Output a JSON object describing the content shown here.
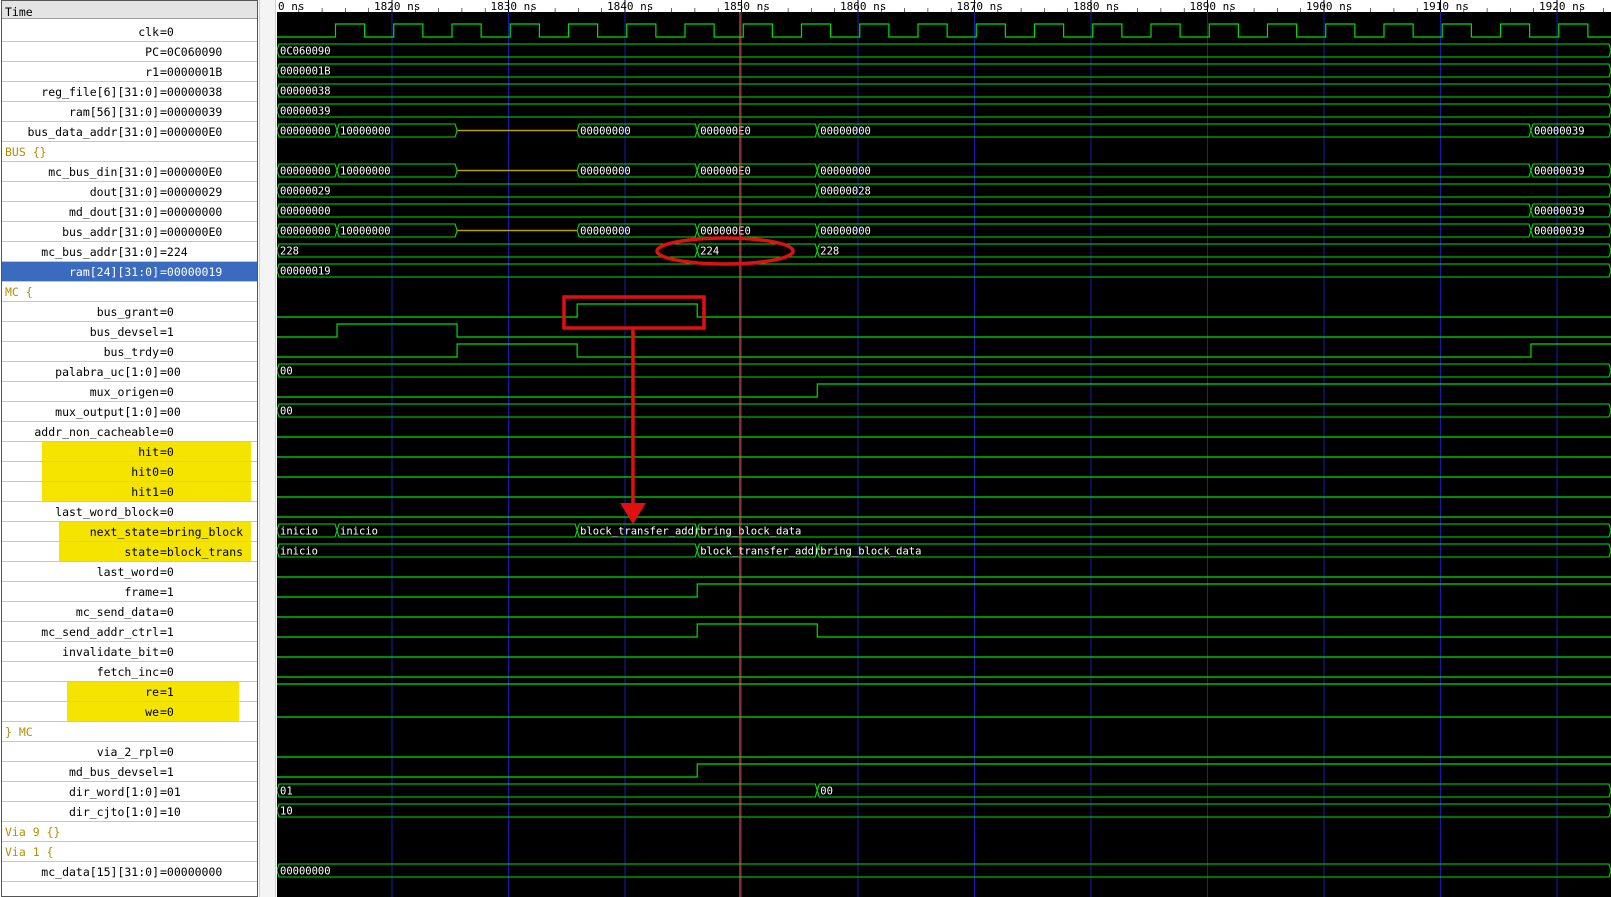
{
  "time_header": "Time",
  "ruler": {
    "first_label": "0 ns",
    "labels": [
      "1820 ns",
      "1830 ns",
      "1840 ns",
      "1850 ns",
      "1860 ns",
      "1870 ns",
      "1880 ns",
      "1890 ns",
      "1900 ns",
      "1910 ns",
      "1920 ns"
    ]
  },
  "signals": [
    {
      "name": "clk",
      "value": "0",
      "kind": "clock"
    },
    {
      "name": "PC",
      "value": "0C060090",
      "kind": "bus",
      "segments": [
        {
          "start": 0,
          "end": 100,
          "label": "0C060090"
        }
      ]
    },
    {
      "name": "r1",
      "value": "0000001B",
      "kind": "bus",
      "segments": [
        {
          "start": 0,
          "end": 100,
          "label": "0000001B"
        }
      ]
    },
    {
      "name": "reg_file[6][31:0]",
      "value": "00000038",
      "kind": "bus",
      "segments": [
        {
          "start": 0,
          "end": 100,
          "label": "00000038"
        }
      ]
    },
    {
      "name": "ram[56][31:0]",
      "value": "00000039",
      "kind": "bus",
      "segments": [
        {
          "start": 0,
          "end": 100,
          "label": "00000039"
        }
      ]
    },
    {
      "name": "bus_data_addr[31:0]",
      "value": "000000E0",
      "kind": "bus",
      "segments": [
        {
          "start": 0,
          "end": 4.5,
          "label": "00000000"
        },
        {
          "start": 4.5,
          "end": 13.5,
          "label": "10000000"
        },
        {
          "start": 13.5,
          "end": 22.5,
          "label": "",
          "z": true
        },
        {
          "start": 22.5,
          "end": 31.5,
          "label": "00000000"
        },
        {
          "start": 31.5,
          "end": 40.5,
          "label": "000000E0"
        },
        {
          "start": 40.5,
          "end": 94,
          "label": "00000000"
        },
        {
          "start": 94,
          "end": 100,
          "label": "00000039"
        }
      ]
    },
    {
      "name": "BUS {}",
      "value": "",
      "kind": "group"
    },
    {
      "name": "mc_bus_din[31:0]",
      "value": "000000E0",
      "kind": "bus",
      "segments": [
        {
          "start": 0,
          "end": 4.5,
          "label": "00000000"
        },
        {
          "start": 4.5,
          "end": 13.5,
          "label": "10000000"
        },
        {
          "start": 13.5,
          "end": 22.5,
          "label": "",
          "z": true
        },
        {
          "start": 22.5,
          "end": 31.5,
          "label": "00000000"
        },
        {
          "start": 31.5,
          "end": 40.5,
          "label": "000000E0"
        },
        {
          "start": 40.5,
          "end": 94,
          "label": "00000000"
        },
        {
          "start": 94,
          "end": 100,
          "label": "00000039"
        }
      ]
    },
    {
      "name": "dout[31:0]",
      "value": "00000029",
      "kind": "bus",
      "segments": [
        {
          "start": 0,
          "end": 40.5,
          "label": "00000029"
        },
        {
          "start": 40.5,
          "end": 100,
          "label": "00000028"
        }
      ]
    },
    {
      "name": "md_dout[31:0]",
      "value": "00000000",
      "kind": "bus",
      "segments": [
        {
          "start": 0,
          "end": 94,
          "label": "00000000"
        },
        {
          "start": 94,
          "end": 100,
          "label": "00000039"
        }
      ]
    },
    {
      "name": "bus_addr[31:0]",
      "value": "000000E0",
      "kind": "bus",
      "segments": [
        {
          "start": 0,
          "end": 4.5,
          "label": "00000000"
        },
        {
          "start": 4.5,
          "end": 13.5,
          "label": "10000000"
        },
        {
          "start": 13.5,
          "end": 22.5,
          "label": "",
          "z": true
        },
        {
          "start": 22.5,
          "end": 31.5,
          "label": "00000000"
        },
        {
          "start": 31.5,
          "end": 40.5,
          "label": "000000E0"
        },
        {
          "start": 40.5,
          "end": 94,
          "label": "00000000"
        },
        {
          "start": 94,
          "end": 100,
          "label": "00000039"
        }
      ]
    },
    {
      "name": "mc_bus_addr[31:0]",
      "value": "224",
      "kind": "bus",
      "segments": [
        {
          "start": 0,
          "end": 31.5,
          "label": "228"
        },
        {
          "start": 31.5,
          "end": 40.5,
          "label": "224"
        },
        {
          "start": 40.5,
          "end": 100,
          "label": "228"
        }
      ]
    },
    {
      "name": "ram[24][31:0]",
      "value": "00000019",
      "kind": "bus",
      "selected": true,
      "segments": [
        {
          "start": 0,
          "end": 100,
          "label": "00000019"
        }
      ]
    },
    {
      "name": "MC {",
      "value": "",
      "kind": "group"
    },
    {
      "name": "bus_grant",
      "value": "0",
      "kind": "bit",
      "levels": [
        [
          0,
          0
        ],
        [
          22.5,
          1
        ],
        [
          31.5,
          0
        ]
      ]
    },
    {
      "name": "bus_devsel",
      "value": "1",
      "kind": "bit",
      "levels": [
        [
          0,
          0
        ],
        [
          4.5,
          1
        ],
        [
          13.5,
          0
        ]
      ]
    },
    {
      "name": "bus_trdy",
      "value": "0",
      "kind": "bit",
      "levels": [
        [
          0,
          0
        ],
        [
          13.5,
          1
        ],
        [
          22.5,
          0
        ],
        [
          94,
          1
        ]
      ]
    },
    {
      "name": "palabra_uc[1:0]",
      "value": "00",
      "kind": "bus",
      "segments": [
        {
          "start": 0,
          "end": 100,
          "label": "00"
        }
      ]
    },
    {
      "name": "mux_origen",
      "value": "0",
      "kind": "bit",
      "levels": [
        [
          0,
          0
        ],
        [
          40.5,
          1
        ]
      ]
    },
    {
      "name": "mux_output[1:0]",
      "value": "00",
      "kind": "bus",
      "segments": [
        {
          "start": 0,
          "end": 100,
          "label": "00"
        }
      ]
    },
    {
      "name": "addr_non_cacheable",
      "value": "0",
      "kind": "bit",
      "levels": [
        [
          0,
          0
        ]
      ]
    },
    {
      "name": "hit",
      "value": "0",
      "kind": "bit",
      "levels": [
        [
          0,
          0
        ]
      ],
      "highlight": true
    },
    {
      "name": "hit0",
      "value": "0",
      "kind": "bit",
      "levels": [
        [
          0,
          0
        ]
      ],
      "highlight": true
    },
    {
      "name": "hit1",
      "value": "0",
      "kind": "bit",
      "levels": [
        [
          0,
          0
        ]
      ],
      "highlight": true
    },
    {
      "name": "last_word_block",
      "value": "0",
      "kind": "bit",
      "levels": [
        [
          0,
          0
        ]
      ]
    },
    {
      "name": "next_state",
      "value": "bring_block",
      "kind": "bus",
      "highlight": true,
      "segments": [
        {
          "start": 0,
          "end": 4.5,
          "label": "inicio"
        },
        {
          "start": 4.5,
          "end": 22.5,
          "label": "inicio"
        },
        {
          "start": 22.5,
          "end": 31.5,
          "label": "block_transfer_addr"
        },
        {
          "start": 31.5,
          "end": 100,
          "label": "bring_block_data"
        }
      ]
    },
    {
      "name": "state",
      "value": "block_trans",
      "kind": "bus",
      "highlight": true,
      "segments": [
        {
          "start": 0,
          "end": 31.5,
          "label": "inicio"
        },
        {
          "start": 31.5,
          "end": 40.5,
          "label": "block_transfer_addr"
        },
        {
          "start": 40.5,
          "end": 100,
          "label": "bring_block_data"
        }
      ]
    },
    {
      "name": "last_word",
      "value": "0",
      "kind": "bit",
      "levels": [
        [
          0,
          0
        ]
      ]
    },
    {
      "name": "frame",
      "value": "1",
      "kind": "bit",
      "levels": [
        [
          0,
          0
        ],
        [
          31.5,
          1
        ]
      ]
    },
    {
      "name": "mc_send_data",
      "value": "0",
      "kind": "bit",
      "levels": [
        [
          0,
          0
        ]
      ]
    },
    {
      "name": "mc_send_addr_ctrl",
      "value": "1",
      "kind": "bit",
      "levels": [
        [
          0,
          0
        ],
        [
          31.5,
          1
        ],
        [
          40.5,
          0
        ]
      ]
    },
    {
      "name": "invalidate_bit",
      "value": "0",
      "kind": "bit",
      "levels": [
        [
          0,
          0
        ]
      ]
    },
    {
      "name": "fetch_inc",
      "value": "0",
      "kind": "bit",
      "levels": [
        [
          0,
          0
        ]
      ]
    },
    {
      "name": "re",
      "value": "1",
      "kind": "bit",
      "levels": [
        [
          0,
          1
        ]
      ],
      "highlight": true
    },
    {
      "name": "we",
      "value": "0",
      "kind": "bit",
      "levels": [
        [
          0,
          0
        ]
      ],
      "highlight": true
    },
    {
      "name": "} MC",
      "value": "",
      "kind": "group"
    },
    {
      "name": "via_2_rpl",
      "value": "0",
      "kind": "bit",
      "levels": [
        [
          0,
          0
        ]
      ]
    },
    {
      "name": "md_bus_devsel",
      "value": "1",
      "kind": "bit",
      "levels": [
        [
          0,
          0
        ],
        [
          31.5,
          1
        ]
      ]
    },
    {
      "name": "dir_word[1:0]",
      "value": "01",
      "kind": "bus",
      "segments": [
        {
          "start": 0,
          "end": 40.5,
          "label": "01"
        },
        {
          "start": 40.5,
          "end": 100,
          "label": "00"
        }
      ]
    },
    {
      "name": "dir_cjto[1:0]",
      "value": "10",
      "kind": "bus",
      "segments": [
        {
          "start": 0,
          "end": 100,
          "label": "10"
        }
      ]
    },
    {
      "name": "Via 9 {}",
      "value": "",
      "kind": "group"
    },
    {
      "name": "Via 1 {",
      "value": "",
      "kind": "group"
    },
    {
      "name": "mc_data[15][31:0]",
      "value": "00000000",
      "kind": "bus",
      "segments": [
        {
          "start": 0,
          "end": 100,
          "label": "00000000"
        }
      ]
    }
  ],
  "colors": {
    "wave": "#00e000",
    "grid": "#1a1ab0",
    "background": "#000000",
    "cursor": "#ff6060",
    "annotation": "#e01010",
    "highlight": "#f5e400",
    "group_text": "#b38f00",
    "zwave": "#b8a000"
  },
  "annotations": [
    "red-ellipse-mc-bus-addr-224",
    "red-box-bus-grant",
    "red-arrow-to-next-state"
  ]
}
